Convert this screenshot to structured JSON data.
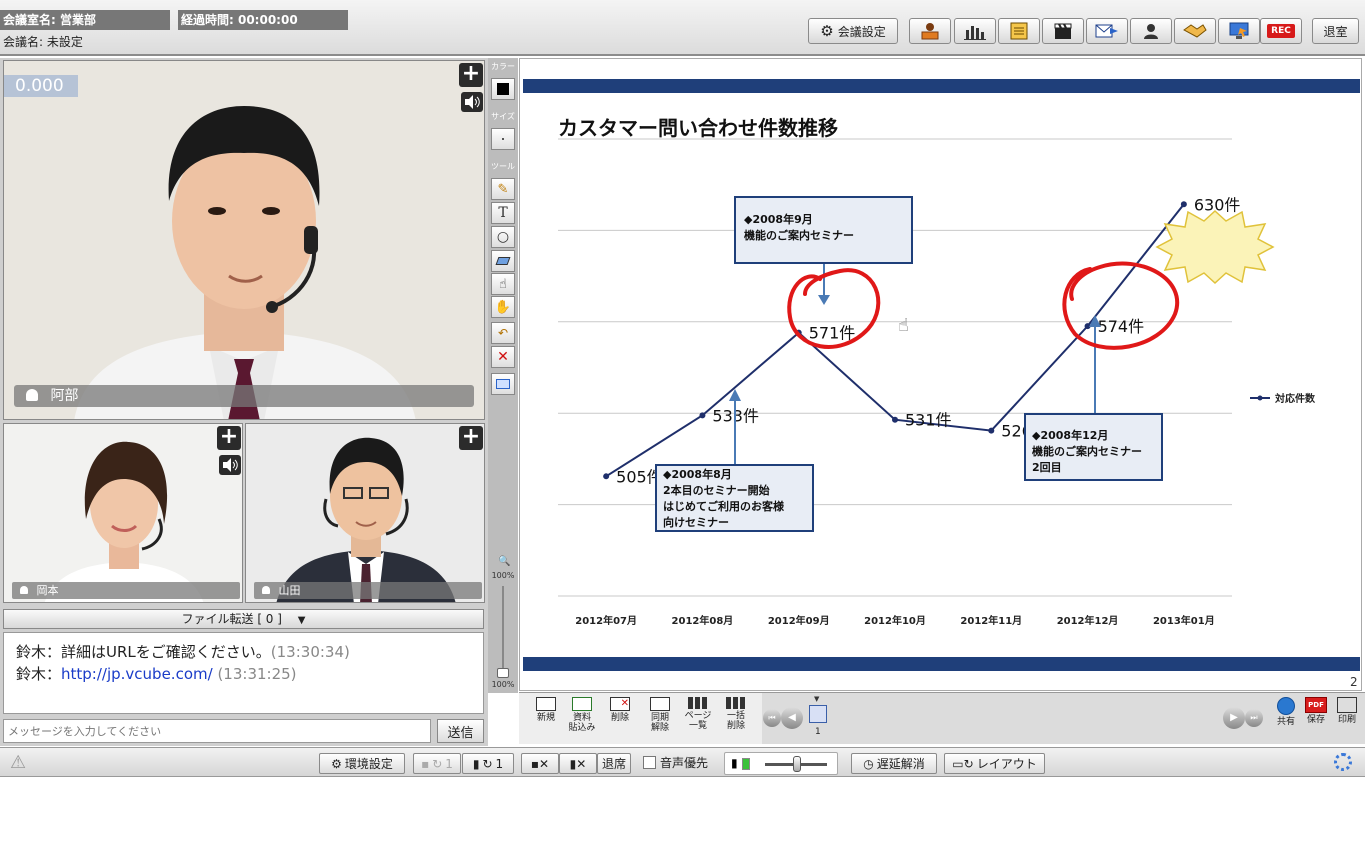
{
  "header": {
    "room_name": "会議室名: 営業部",
    "elapsed": "経過時間: 00:00:00",
    "meeting_name": "会議名: 未設定",
    "settings_label": "会議設定",
    "rec_label": "REC",
    "leave_label": "退室"
  },
  "videos": {
    "main": {
      "counter": "0.000",
      "name": "阿部"
    },
    "sub1": {
      "name": "岡本"
    },
    "sub2": {
      "name": "山田"
    }
  },
  "tools": {
    "color_label": "カラー",
    "size_label": "サイズ",
    "tool_label": "ツール",
    "text_tool": "T",
    "zoom_top": "100%",
    "zoom_bottom": "100%"
  },
  "file_transfer": {
    "label": "ファイル転送 [ 0 ]"
  },
  "chat": {
    "messages": [
      {
        "sender": "鈴木：",
        "text": "詳細はURLをご確認ください。",
        "time": "(13:30:34)"
      },
      {
        "sender": "鈴木：",
        "text": "http://jp.vcube.com/",
        "time": "(13:31:25)"
      }
    ],
    "placeholder": "メッセージを入力してください",
    "send_label": "送信"
  },
  "slide": {
    "title": "カスタマー問い合わせ件数推移",
    "page_number": "2",
    "legend": "対応件数",
    "annotations": [
      "◆2008年9月\n機能のご案内セミナー",
      "◆2008年8月\n2本目のセミナー開始\nはじめてご利用のお客様\n向けセミナー",
      "◆2008年12月\n機能のご案内セミナー\n2回目"
    ]
  },
  "chart_data": {
    "type": "line",
    "title": "カスタマー問い合わせ件数推移",
    "categories": [
      "2012年07月",
      "2012年08月",
      "2012年09月",
      "2012年10月",
      "2012年11月",
      "2012年12月",
      "2013年01月"
    ],
    "series": [
      {
        "name": "対応件数",
        "values": [
          505,
          533,
          571,
          531,
          526,
          574,
          630
        ]
      }
    ],
    "data_labels": [
      "505件",
      "533件",
      "571件",
      "531件",
      "526件",
      "574件",
      "630件"
    ],
    "ylim": [
      450,
      660
    ],
    "grid": true,
    "legend_position": "right",
    "line_color": "#1f2f6b"
  },
  "slide_tools": {
    "new": "新規",
    "paste": "資料\n貼込み",
    "delete": "削除",
    "sync_release": "同期\n解除",
    "page_list": "ページ\n一覧",
    "delete_all": "一括\n削除",
    "page_indicator": "1",
    "share": "共有",
    "save": "保存",
    "pdf": "PDF",
    "print": "印刷"
  },
  "statusbar": {
    "env_settings": "環境設定",
    "cam_count": "1",
    "sync_count": "1",
    "leave_seat": "退席",
    "audio_priority": "音声優先",
    "delay_release": "遅延解消",
    "layout": "レイアウト"
  }
}
